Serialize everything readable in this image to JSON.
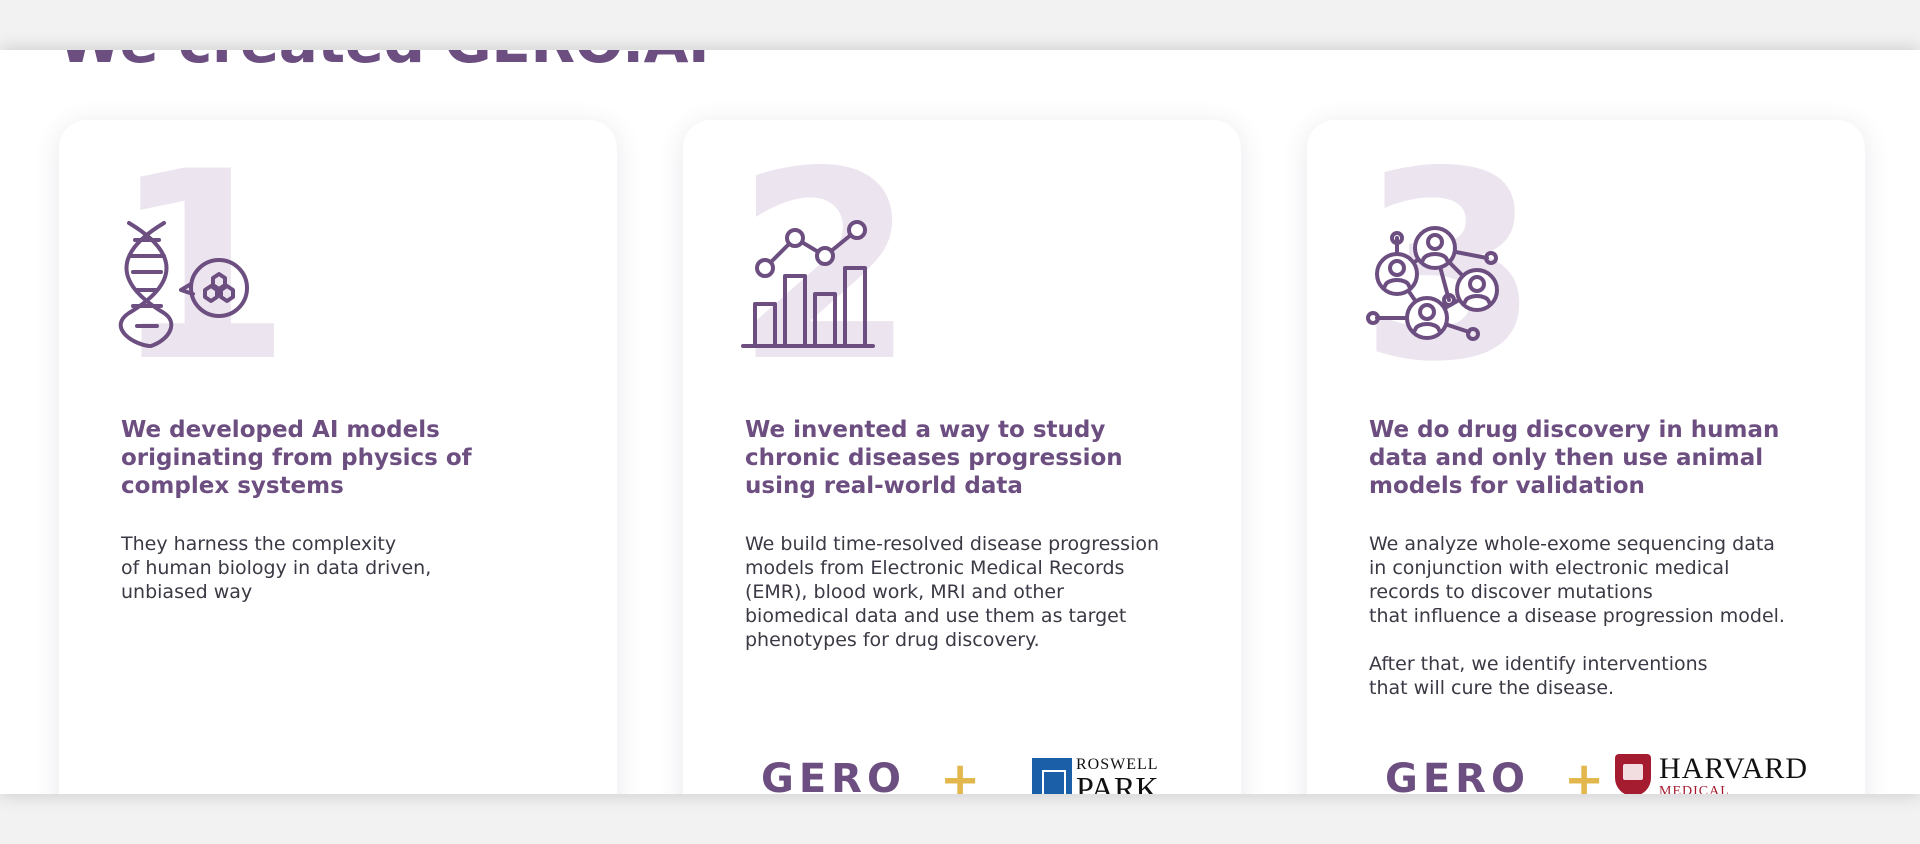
{
  "page": {
    "heading": "We created GERO.AI"
  },
  "cards": [
    {
      "number": "1",
      "icon": "dna-molecule-icon",
      "title": "We developed AI models originating from physics of complex systems",
      "text": "They harness the complexity\nof human biology in data driven,\nunbiased way",
      "logos": null
    },
    {
      "number": "2",
      "icon": "growth-chart-icon",
      "title": "We invented a way to study chronic diseases progression using real-world data",
      "text": "We build time-resolved disease progression\nmodels from Electronic Medical Records\n(EMR), blood work, MRI and other\nbiomedical data and use them as target\nphenotypes for drug discovery.",
      "logos": {
        "gero": "GERO",
        "plus": "+",
        "partner_line1": "ROSWELL",
        "partner_line2": "PARK"
      }
    },
    {
      "number": "3",
      "icon": "people-network-icon",
      "title": "We do drug discovery in human data and only then use animal models for validation",
      "text": "We analyze whole-exome sequencing data\nin conjunction with electronic medical\nrecords to discover mutations\nthat influence a disease progression model.\n\nAfter that, we identify interventions\nthat will cure the disease.",
      "logos": {
        "gero": "GERO",
        "plus": "+",
        "partner_line1": "HARVARD",
        "partner_line2": "MEDICAL SCHOOL"
      }
    }
  ],
  "colors": {
    "brand_purple": "#6c4e80",
    "number_tint": "#ece4ee",
    "accent_gold": "#e2b84e",
    "harvard_crimson": "#a51c30",
    "roswell_blue": "#1a5fa8"
  }
}
